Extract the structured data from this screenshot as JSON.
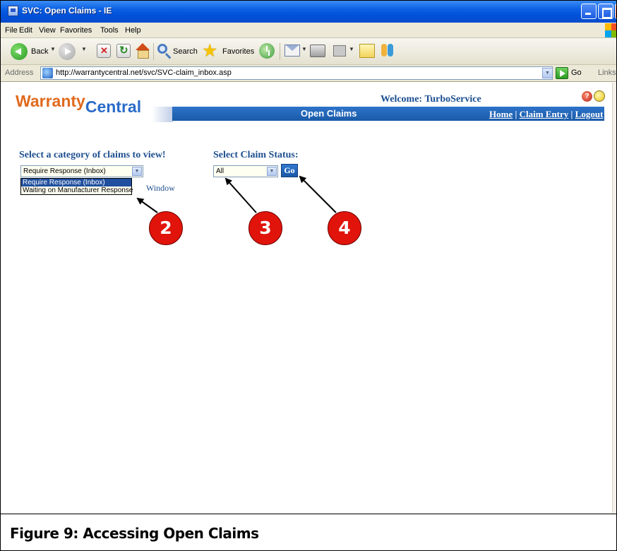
{
  "window": {
    "title": "SVC: Open Claims - IE"
  },
  "menu": {
    "items": [
      "File",
      "Edit",
      "View",
      "Favorites",
      "Tools",
      "Help"
    ]
  },
  "toolbar": {
    "back_label": "Back",
    "search_label": "Search",
    "favorites_label": "Favorites"
  },
  "address": {
    "label": "Address",
    "url": "http://warrantycentral.net/svc/SVC-claim_inbox.asp",
    "go_label": "Go",
    "links_label": "Links"
  },
  "header": {
    "logo_part1": "Warranty",
    "logo_part2": "Central",
    "welcome": "Welcome: TurboService",
    "bar_title": "Open Claims",
    "nav": [
      "Home",
      "Claim Entry",
      "Logout"
    ],
    "nav_separator": "|"
  },
  "filters": {
    "category_heading": "Select a category of claims to view!",
    "category_selected": "Require Response (Inbox)",
    "category_options": [
      "Require Response (Inbox)",
      "Waiting on Manufacturer Response"
    ],
    "partial_text": "Window",
    "status_heading": "Select Claim Status:",
    "status_selected": "All",
    "go_button": "Go"
  },
  "callouts": [
    "2",
    "3",
    "4"
  ],
  "caption": "Figure 9: Accessing Open Claims",
  "colors": {
    "title_bar": "#0a5fe3",
    "header_bar": "#1a5aa8",
    "heading_text": "#1f4f8f",
    "callout": "#e1140b",
    "logo_orange": "#e06a1e",
    "logo_blue": "#2a6bc8"
  }
}
